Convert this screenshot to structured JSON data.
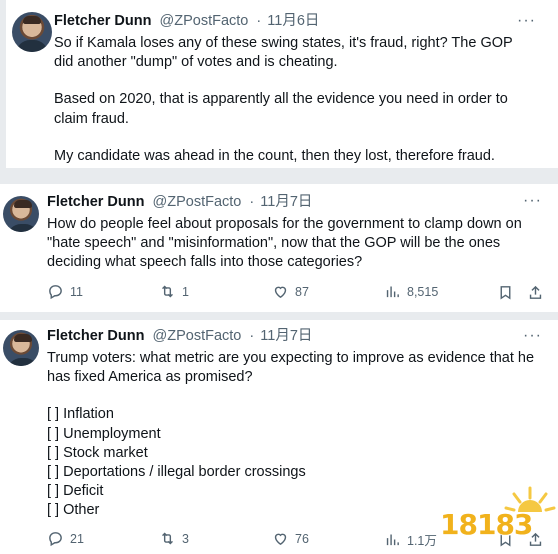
{
  "tweets": [
    {
      "author": "Fletcher Dunn",
      "handle": "@ZPostFacto",
      "separator": "·",
      "date": "11月6日",
      "more": "···",
      "paragraphs": [
        "So if Kamala loses any of these swing states, it's fraud, right?  The GOP did another \"dump\" of votes and is cheating.",
        "Based on 2020, that is apparently all the evidence you need in order to claim fraud.",
        "My candidate was ahead in the count, then they lost, therefore fraud. QED"
      ]
    },
    {
      "author": "Fletcher Dunn",
      "handle": "@ZPostFacto",
      "separator": "·",
      "date": "11月7日",
      "more": "···",
      "paragraphs": [
        "How do people feel about proposals for the government to clamp down on \"hate speech\" and \"misinformation\", now that the GOP will be the ones deciding what speech falls into those categories?"
      ],
      "replies": "11",
      "retweets": "1",
      "likes": "87",
      "views": "8,515"
    },
    {
      "author": "Fletcher Dunn",
      "handle": "@ZPostFacto",
      "separator": "·",
      "date": "11月7日",
      "more": "···",
      "paragraphs": [
        "Trump voters: what metric are you expecting to improve as evidence that he has fixed America as promised?"
      ],
      "options": [
        "[ ] Inflation",
        "[ ] Unemployment",
        "[ ] Stock market",
        "[ ] Deportations / illegal border crossings",
        "[ ] Deficit",
        "[ ] Other"
      ],
      "replies": "21",
      "retweets": "3",
      "likes": "76",
      "views": "1.1万"
    }
  ],
  "icons": {
    "reply": "reply-icon",
    "retweet": "retweet-icon",
    "like": "heart-icon",
    "views": "views-chart-icon",
    "bookmark": "bookmark-icon",
    "share": "share-icon"
  },
  "watermark": {
    "text": "18183"
  },
  "colors": {
    "text": "#0f1419",
    "muted": "#536471",
    "background": "#e8ebee",
    "watermark": "#f1b21c"
  }
}
